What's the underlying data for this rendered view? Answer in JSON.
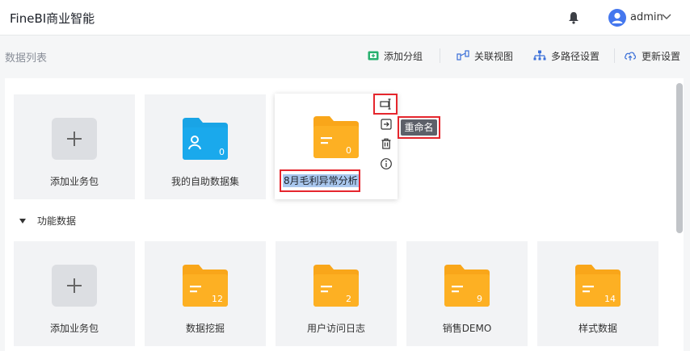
{
  "app": {
    "title": "FineBI商业智能",
    "user": "admin"
  },
  "toolbar": {
    "title": "数据列表",
    "add_group": "添加分组",
    "relation_view": "关联视图",
    "multipath": "多路径设置",
    "update": "更新设置"
  },
  "top_cards": [
    {
      "label": "添加业务包",
      "type": "add"
    },
    {
      "label": "我的自助数据集",
      "type": "user-folder",
      "count": "0"
    },
    {
      "label": "8月毛利异常分析",
      "type": "folder",
      "count": "0"
    }
  ],
  "tooltip": "重命名",
  "section": {
    "label": "功能数据"
  },
  "function_cards": [
    {
      "label": "添加业务包",
      "type": "add"
    },
    {
      "label": "数据挖掘",
      "count": "12"
    },
    {
      "label": "用户访问日志",
      "count": "2"
    },
    {
      "label": "销售DEMO",
      "count": "9"
    },
    {
      "label": "样式数据",
      "count": "14"
    }
  ],
  "colors": {
    "folder": "#f9a61a",
    "blue_folder": "#19a4e6",
    "accent": "#4477ee",
    "highlight": "#e5262d"
  }
}
